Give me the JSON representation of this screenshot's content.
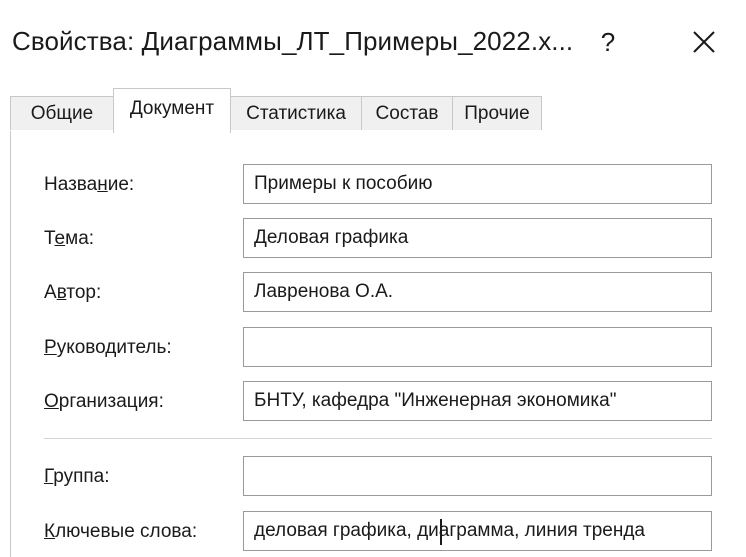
{
  "window": {
    "title": "Свойства: Диаграммы_ЛТ_Примеры_2022.x...",
    "help_label": "?"
  },
  "tabs": [
    {
      "label": "Общие",
      "active": false
    },
    {
      "label": "Документ",
      "active": true
    },
    {
      "label": "Статистика",
      "active": false
    },
    {
      "label": "Состав",
      "active": false
    },
    {
      "label": "Прочие",
      "active": false
    }
  ],
  "fields": {
    "title": {
      "label_pre": "Назва",
      "label_acc": "н",
      "label_post": "ие:",
      "value": "Примеры к пособию"
    },
    "subject": {
      "label_pre": "Т",
      "label_acc": "е",
      "label_post": "ма:",
      "value": "Деловая графика"
    },
    "author": {
      "label_pre": "А",
      "label_acc": "в",
      "label_post": "тор:",
      "value": "Лавренова О.А."
    },
    "manager": {
      "label_pre": "",
      "label_acc": "Р",
      "label_post": "уководитель:",
      "value": ""
    },
    "company": {
      "label_pre": "",
      "label_acc": "О",
      "label_post": "рганизация:",
      "value": "БНТУ, кафедра \"Инженерная экономика\""
    },
    "category": {
      "label_pre": "",
      "label_acc": "Г",
      "label_post": "руппа:",
      "value": ""
    },
    "keywords": {
      "label_pre": "",
      "label_acc": "К",
      "label_post": "лючевые слова:",
      "value": "деловая графика, диаграмма, линия тренда"
    }
  },
  "icons": {
    "close": "close-icon",
    "help": "question-mark"
  }
}
